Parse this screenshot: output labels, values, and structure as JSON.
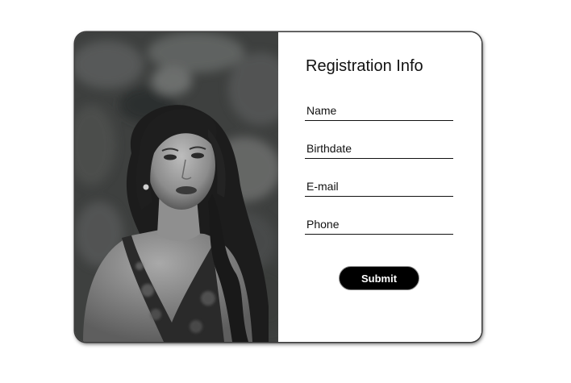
{
  "form": {
    "title": "Registration Info",
    "fields": [
      {
        "placeholder": "Name",
        "value": ""
      },
      {
        "placeholder": "Birthdate",
        "value": ""
      },
      {
        "placeholder": "E-mail",
        "value": ""
      },
      {
        "placeholder": "Phone",
        "value": ""
      }
    ],
    "submit_label": "Submit"
  },
  "colors": {
    "card_border": "#3a3a3a",
    "button_bg": "#000000",
    "button_text": "#ffffff",
    "underline": "#111111"
  }
}
